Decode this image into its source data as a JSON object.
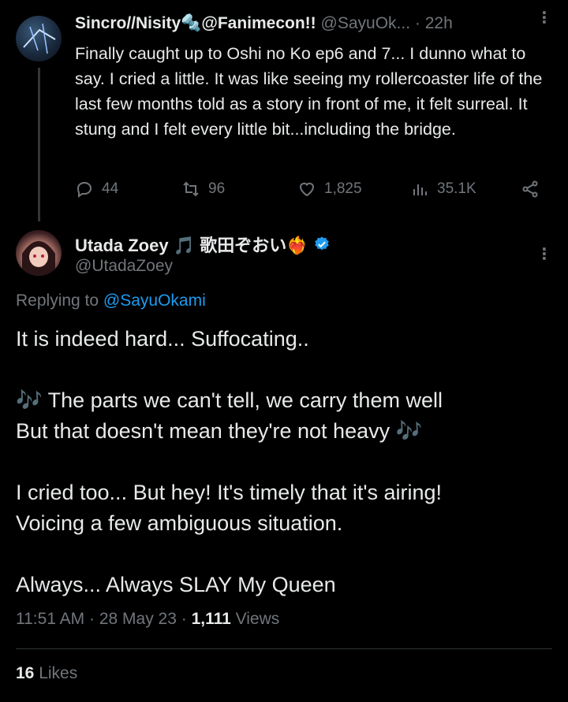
{
  "parent": {
    "name": "Sincro//Nisity🔩@Fanimecon!!",
    "handle": "@SayuOk...",
    "time": "· 22h",
    "text": "Finally caught up to Oshi no Ko ep6 and 7... I dunno what to say. I cried a little. It was like seeing my rollercoaster life of the last few months told as a story in front of me, it felt surreal. It stung and I felt every little bit...including the bridge.",
    "actions": {
      "replies": "44",
      "retweets": "96",
      "likes": "1,825",
      "views": "35.1K"
    }
  },
  "reply": {
    "name": "Utada Zoey 🎵 歌田ぞおい❤️‍🔥",
    "handle": "@UtadaZoey",
    "replying_prefix": "Replying to ",
    "replying_to": "@SayuOkami",
    "paragraphs": [
      "It is indeed hard... Suffocating..",
      "🎶 The parts we can't tell, we carry them well",
      "But that doesn't mean they're not heavy 🎶",
      "I cried too... But hey! It's timely that it's airing!",
      "Voicing a few ambiguous situation.",
      "Always... Always SLAY My Queen"
    ],
    "time": "11:51 AM · 28 May 23 · ",
    "views_count": "1,111",
    "views_label": " Views",
    "likes_count": "16",
    "likes_label": " Likes"
  },
  "colors": {
    "background": "#000000",
    "text": "#e7e9ea",
    "secondary": "#71767b",
    "accent": "#1d9bf0"
  }
}
